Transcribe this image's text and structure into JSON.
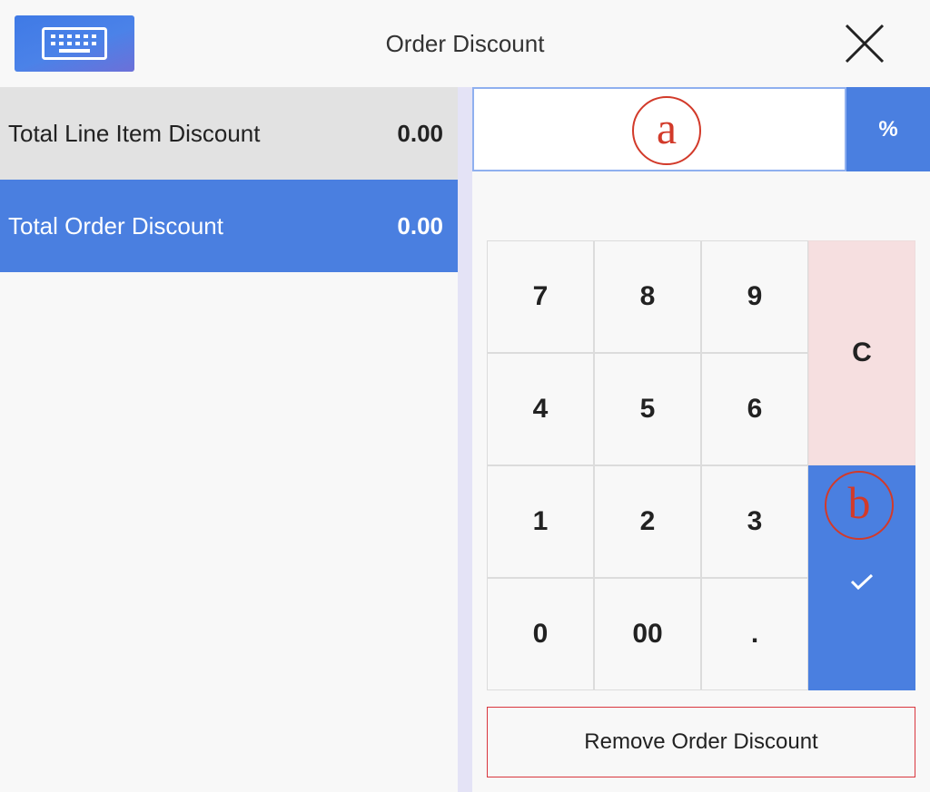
{
  "header": {
    "title": "Order Discount",
    "keyboard_icon": "keyboard-icon",
    "close_icon": "close-icon"
  },
  "summary": {
    "rows": [
      {
        "label": "Total Line Item Discount",
        "value": "0.00",
        "selected": false
      },
      {
        "label": "Total Order Discount",
        "value": "0.00",
        "selected": true
      }
    ]
  },
  "entry": {
    "value": "",
    "mode_label": "%"
  },
  "annotations": {
    "a": "a",
    "b": "b"
  },
  "keypad": {
    "keys": [
      "7",
      "8",
      "9",
      "4",
      "5",
      "6",
      "1",
      "2",
      "3",
      "0",
      "00",
      "."
    ],
    "clear_label": "C",
    "confirm_icon": "check-icon"
  },
  "actions": {
    "remove_label": "Remove Order Discount"
  },
  "colors": {
    "accent": "#4a7fe0",
    "clear_bg": "#f6dfe0",
    "danger_border": "#d9363e",
    "annotation": "#d23a2a"
  }
}
